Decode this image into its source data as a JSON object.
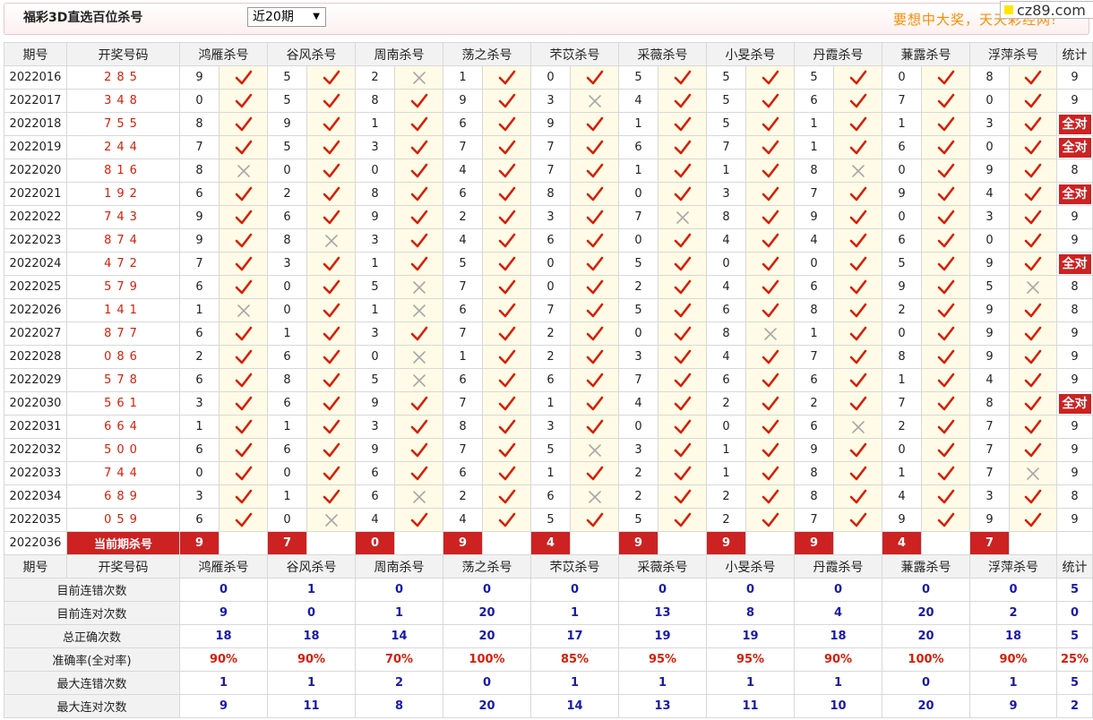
{
  "header": {
    "title": "福彩3D直选百位杀号",
    "period_select": "近20期",
    "slogan": "要想中大奖，天天彩经网!",
    "logo_text": "cz89.com"
  },
  "table": {
    "col_issue": "期号",
    "col_numbers": "开奖号码",
    "experts": [
      "鸿雁杀号",
      "谷风杀号",
      "周南杀号",
      "荡之杀号",
      "芣苡杀号",
      "采薇杀号",
      "小旻杀号",
      "丹霞杀号",
      "蒹露杀号",
      "浮萍杀号"
    ],
    "col_stat": "统计",
    "rows": [
      {
        "issue": "2022016",
        "nums": "285",
        "kills": [
          "9",
          "5",
          "2",
          "1",
          "0",
          "5",
          "5",
          "5",
          "0",
          "8"
        ],
        "ok": [
          1,
          1,
          0,
          1,
          1,
          1,
          1,
          1,
          1,
          1
        ],
        "stat": "9"
      },
      {
        "issue": "2022017",
        "nums": "348",
        "kills": [
          "0",
          "5",
          "8",
          "9",
          "3",
          "4",
          "5",
          "6",
          "7",
          "0"
        ],
        "ok": [
          1,
          1,
          1,
          1,
          0,
          1,
          1,
          1,
          1,
          1
        ],
        "stat": "9"
      },
      {
        "issue": "2022018",
        "nums": "755",
        "kills": [
          "8",
          "9",
          "1",
          "6",
          "9",
          "1",
          "5",
          "1",
          "1",
          "3"
        ],
        "ok": [
          1,
          1,
          1,
          1,
          1,
          1,
          1,
          1,
          1,
          1
        ],
        "stat": "全对"
      },
      {
        "issue": "2022019",
        "nums": "244",
        "kills": [
          "7",
          "5",
          "3",
          "7",
          "7",
          "6",
          "7",
          "1",
          "6",
          "0"
        ],
        "ok": [
          1,
          1,
          1,
          1,
          1,
          1,
          1,
          1,
          1,
          1
        ],
        "stat": "全对"
      },
      {
        "issue": "2022020",
        "nums": "816",
        "kills": [
          "8",
          "0",
          "0",
          "4",
          "7",
          "1",
          "1",
          "8",
          "0",
          "9"
        ],
        "ok": [
          0,
          1,
          1,
          1,
          1,
          1,
          1,
          0,
          1,
          1
        ],
        "stat": "8"
      },
      {
        "issue": "2022021",
        "nums": "192",
        "kills": [
          "6",
          "2",
          "8",
          "6",
          "8",
          "0",
          "3",
          "7",
          "9",
          "4"
        ],
        "ok": [
          1,
          1,
          1,
          1,
          1,
          1,
          1,
          1,
          1,
          1
        ],
        "stat": "全对"
      },
      {
        "issue": "2022022",
        "nums": "743",
        "kills": [
          "9",
          "6",
          "9",
          "2",
          "3",
          "7",
          "8",
          "9",
          "0",
          "3"
        ],
        "ok": [
          1,
          1,
          1,
          1,
          1,
          0,
          1,
          1,
          1,
          1
        ],
        "stat": "9"
      },
      {
        "issue": "2022023",
        "nums": "874",
        "kills": [
          "9",
          "8",
          "3",
          "4",
          "6",
          "0",
          "4",
          "4",
          "6",
          "0"
        ],
        "ok": [
          1,
          0,
          1,
          1,
          1,
          1,
          1,
          1,
          1,
          1
        ],
        "stat": "9"
      },
      {
        "issue": "2022024",
        "nums": "472",
        "kills": [
          "7",
          "3",
          "1",
          "5",
          "0",
          "5",
          "0",
          "0",
          "5",
          "9"
        ],
        "ok": [
          1,
          1,
          1,
          1,
          1,
          1,
          1,
          1,
          1,
          1
        ],
        "stat": "全对"
      },
      {
        "issue": "2022025",
        "nums": "579",
        "kills": [
          "6",
          "0",
          "5",
          "7",
          "0",
          "2",
          "4",
          "6",
          "9",
          "5"
        ],
        "ok": [
          1,
          1,
          0,
          1,
          1,
          1,
          1,
          1,
          1,
          0
        ],
        "stat": "8"
      },
      {
        "issue": "2022026",
        "nums": "141",
        "kills": [
          "1",
          "0",
          "1",
          "6",
          "7",
          "5",
          "6",
          "8",
          "2",
          "9"
        ],
        "ok": [
          0,
          1,
          0,
          1,
          1,
          1,
          1,
          1,
          1,
          1
        ],
        "stat": "8"
      },
      {
        "issue": "2022027",
        "nums": "877",
        "kills": [
          "6",
          "1",
          "3",
          "7",
          "2",
          "0",
          "8",
          "1",
          "0",
          "9"
        ],
        "ok": [
          1,
          1,
          1,
          1,
          1,
          1,
          0,
          1,
          1,
          1
        ],
        "stat": "9"
      },
      {
        "issue": "2022028",
        "nums": "086",
        "kills": [
          "2",
          "6",
          "0",
          "1",
          "2",
          "3",
          "4",
          "7",
          "8",
          "9"
        ],
        "ok": [
          1,
          1,
          0,
          1,
          1,
          1,
          1,
          1,
          1,
          1
        ],
        "stat": "9"
      },
      {
        "issue": "2022029",
        "nums": "578",
        "kills": [
          "6",
          "8",
          "5",
          "6",
          "6",
          "7",
          "6",
          "6",
          "1",
          "4"
        ],
        "ok": [
          1,
          1,
          0,
          1,
          1,
          1,
          1,
          1,
          1,
          1
        ],
        "stat": "9"
      },
      {
        "issue": "2022030",
        "nums": "561",
        "kills": [
          "3",
          "6",
          "9",
          "7",
          "1",
          "4",
          "2",
          "2",
          "7",
          "8"
        ],
        "ok": [
          1,
          1,
          1,
          1,
          1,
          1,
          1,
          1,
          1,
          1
        ],
        "stat": "全对"
      },
      {
        "issue": "2022031",
        "nums": "664",
        "kills": [
          "1",
          "1",
          "3",
          "8",
          "3",
          "0",
          "0",
          "6",
          "2",
          "7"
        ],
        "ok": [
          1,
          1,
          1,
          1,
          1,
          1,
          1,
          0,
          1,
          1
        ],
        "stat": "9"
      },
      {
        "issue": "2022032",
        "nums": "500",
        "kills": [
          "6",
          "6",
          "9",
          "7",
          "5",
          "3",
          "1",
          "9",
          "0",
          "7"
        ],
        "ok": [
          1,
          1,
          1,
          1,
          0,
          1,
          1,
          1,
          1,
          1
        ],
        "stat": "9"
      },
      {
        "issue": "2022033",
        "nums": "744",
        "kills": [
          "0",
          "0",
          "6",
          "6",
          "1",
          "2",
          "1",
          "8",
          "1",
          "7"
        ],
        "ok": [
          1,
          1,
          1,
          1,
          1,
          1,
          1,
          1,
          1,
          0
        ],
        "stat": "9"
      },
      {
        "issue": "2022034",
        "nums": "689",
        "kills": [
          "3",
          "1",
          "6",
          "2",
          "6",
          "2",
          "2",
          "8",
          "4",
          "3"
        ],
        "ok": [
          1,
          1,
          0,
          1,
          0,
          1,
          1,
          1,
          1,
          1
        ],
        "stat": "8"
      },
      {
        "issue": "2022035",
        "nums": "059",
        "kills": [
          "6",
          "0",
          "4",
          "4",
          "5",
          "5",
          "2",
          "7",
          "9",
          "9"
        ],
        "ok": [
          1,
          0,
          1,
          1,
          1,
          1,
          1,
          1,
          1,
          1
        ],
        "stat": "9"
      }
    ],
    "current": {
      "issue": "2022036",
      "label": "当前期杀号",
      "kills": [
        "9",
        "7",
        "0",
        "9",
        "4",
        "9",
        "9",
        "9",
        "4",
        "7"
      ]
    },
    "summary_header": {
      "col_issue": "期号",
      "col_numbers": "开奖号码"
    },
    "summary": [
      {
        "label": "目前连错次数",
        "values": [
          "0",
          "1",
          "0",
          "0",
          "0",
          "0",
          "0",
          "0",
          "0",
          "0"
        ],
        "stat": "5",
        "red": false
      },
      {
        "label": "目前连对次数",
        "values": [
          "9",
          "0",
          "1",
          "20",
          "1",
          "13",
          "8",
          "4",
          "20",
          "2"
        ],
        "stat": "0",
        "red": false
      },
      {
        "label": "总正确次数",
        "values": [
          "18",
          "18",
          "14",
          "20",
          "17",
          "19",
          "19",
          "18",
          "20",
          "18"
        ],
        "stat": "5",
        "red": false
      },
      {
        "label": "准确率(全对率)",
        "values": [
          "90%",
          "90%",
          "70%",
          "100%",
          "85%",
          "95%",
          "95%",
          "90%",
          "100%",
          "90%"
        ],
        "stat": "25%",
        "red": true
      },
      {
        "label": "最大连错次数",
        "values": [
          "1",
          "1",
          "2",
          "0",
          "1",
          "1",
          "1",
          "1",
          "0",
          "1"
        ],
        "stat": "5",
        "red": false
      },
      {
        "label": "最大连对次数",
        "values": [
          "9",
          "11",
          "8",
          "20",
          "14",
          "13",
          "11",
          "10",
          "20",
          "9"
        ],
        "stat": "2",
        "red": false
      }
    ]
  },
  "icons": {
    "correct": "check-icon",
    "wrong": "cross-icon"
  },
  "colors": {
    "accent_red": "#cc2222",
    "number_red": "#d81e06",
    "stat_blue": "#1a1aa8",
    "slogan_orange": "#ff8c00",
    "mark_bg": "#fffbe6"
  }
}
